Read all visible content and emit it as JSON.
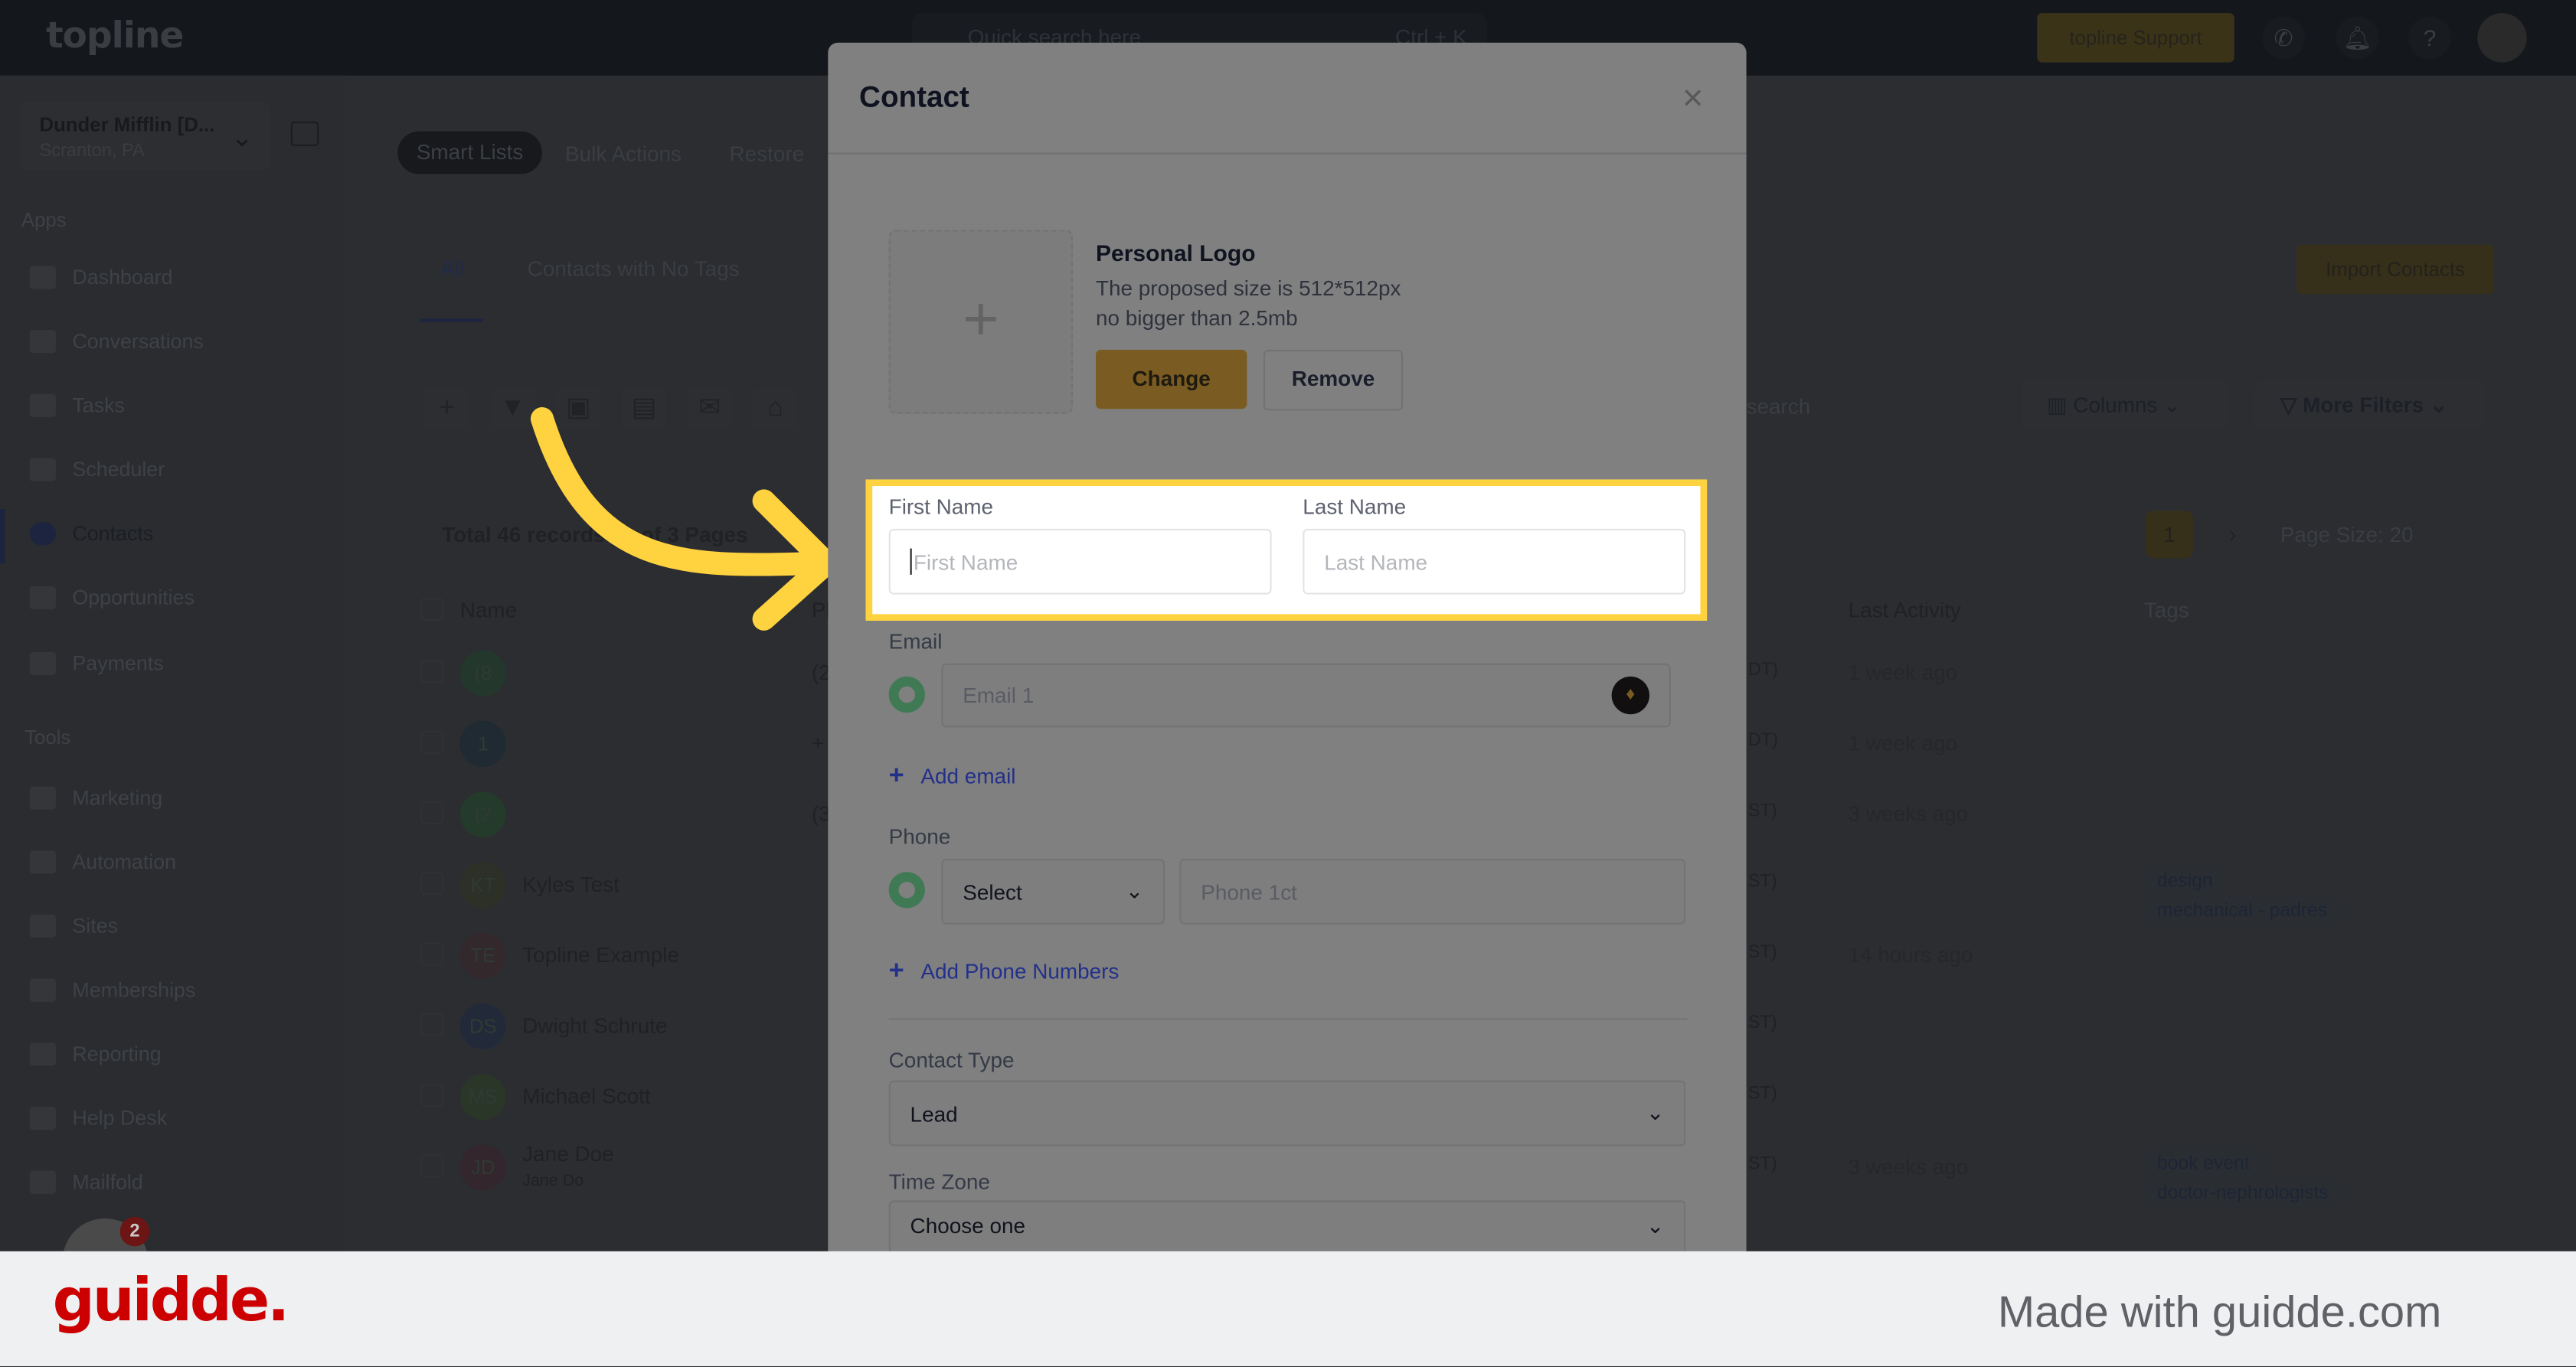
{
  "topbar": {
    "logo": "topline",
    "search_placeholder": "Quick search here",
    "search_shortcut": "Ctrl + K",
    "support_label": "topline Support",
    "help": "?"
  },
  "sidebar": {
    "location_name": "Dunder Mifflin [D...",
    "location_sub": "Scranton, PA",
    "apps_heading": "Apps",
    "tools_heading": "Tools",
    "apps": [
      {
        "label": "Dashboard",
        "icon": "dashboard-icon"
      },
      {
        "label": "Conversations",
        "icon": "chat-icon"
      },
      {
        "label": "Tasks",
        "icon": "tasks-icon"
      },
      {
        "label": "Scheduler",
        "icon": "calendar-icon"
      },
      {
        "label": "Contacts",
        "icon": "person-icon",
        "active": true
      },
      {
        "label": "Opportunities",
        "icon": "target-icon"
      },
      {
        "label": "Payments",
        "icon": "card-icon"
      }
    ],
    "tools": [
      {
        "label": "Marketing",
        "icon": "megaphone-icon"
      },
      {
        "label": "Automation",
        "icon": "gears-icon"
      },
      {
        "label": "Sites",
        "icon": "globe-icon"
      },
      {
        "label": "Memberships",
        "icon": "users-icon"
      },
      {
        "label": "Reporting",
        "icon": "pie-icon"
      },
      {
        "label": "Help Desk",
        "icon": "help-icon"
      },
      {
        "label": "Mailfold",
        "icon": "mail-icon"
      }
    ],
    "notification_count": "2"
  },
  "main": {
    "top_tabs": [
      "Smart Lists",
      "Bulk Actions",
      "Restore"
    ],
    "list_tabs": [
      "All",
      "Contacts with No Tags"
    ],
    "import_label": "Import Contacts",
    "search_placeholder": "search",
    "columns_label": "Columns",
    "more_filters_label": "More Filters",
    "total_text": "Total 46 records | 1 of 3 Pages",
    "page_current": "1",
    "page_size": "Page Size: 20",
    "headers": {
      "name": "Name",
      "phone": "Ph",
      "last_activity": "Last Activity",
      "tags": "Tags"
    },
    "rows": [
      {
        "initials": "(8",
        "name": "",
        "phone": "(2",
        "tz": "DT)",
        "activity": "1 week ago",
        "tags": [],
        "color": "#23372c"
      },
      {
        "initials": "1",
        "name": "",
        "phone": "+",
        "tz": "DT)",
        "activity": "1 week ago",
        "tags": [],
        "color": "#1f2a33"
      },
      {
        "initials": "(2",
        "name": "",
        "phone": "(3",
        "tz": "ST)",
        "activity": "3 weeks ago",
        "tags": [],
        "color": "#243a2a"
      },
      {
        "initials": "KT",
        "name": "Kyles Test",
        "phone": "",
        "tz": "ST)",
        "activity": "",
        "tags": [
          "design",
          "mechanical - padres"
        ],
        "color": "#2d3026"
      },
      {
        "initials": "TE",
        "name": "Topline Example",
        "phone": "",
        "tz": "ST)",
        "activity": "14 hours ago",
        "tags": [],
        "color": "#33282c"
      },
      {
        "initials": "DS",
        "name": "Dwight Schrute",
        "phone": "",
        "tz": "ST)",
        "activity": "",
        "tags": [],
        "color": "#222a3a"
      },
      {
        "initials": "MS",
        "name": "Michael Scott",
        "phone": "",
        "tz": "ST)",
        "activity": "",
        "tags": [],
        "color": "#2a3628"
      },
      {
        "initials": "JD",
        "name": "Jane Doe",
        "sub": "Jane Do",
        "phone": "",
        "tz": "ST)",
        "activity": "3 weeks ago",
        "tags": [
          "book event",
          "doctor-nephrologists"
        ],
        "color": "#33262c"
      }
    ]
  },
  "modal": {
    "title": "Contact",
    "logo_title": "Personal Logo",
    "logo_hint1": "The proposed size is 512*512px",
    "logo_hint2": "no bigger than 2.5mb",
    "change_label": "Change",
    "remove_label": "Remove",
    "first_name_label": "First Name",
    "first_name_placeholder": "First Name",
    "last_name_label": "Last Name",
    "last_name_placeholder": "Last Name",
    "email_label": "Email",
    "email_placeholder": "Email 1",
    "add_email": "Add email",
    "phone_label": "Phone",
    "phone_select": "Select",
    "phone_placeholder": "Phone 1ct",
    "add_phone": "Add Phone Numbers",
    "contact_type_label": "Contact Type",
    "contact_type_value": "Lead",
    "time_zone_label": "Time Zone",
    "time_zone_value": "Choose one"
  },
  "footer": {
    "brand": "guidde.",
    "tagline": "Made with guidde.com"
  },
  "colors": {
    "highlight": "#ffd23f",
    "brand_red": "#cc0000",
    "accent_gold": "#d4a72c"
  }
}
